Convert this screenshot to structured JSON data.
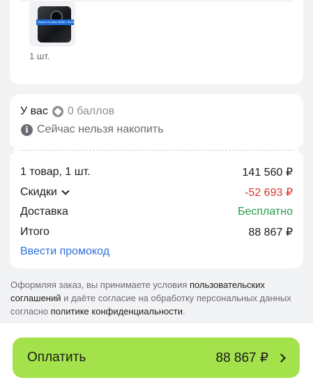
{
  "product": {
    "thumb_label": "Xiaomi 15 Ultra 16GB + 512GB",
    "quantity": "1 шт."
  },
  "points": {
    "you_have": "У вас",
    "balance": "0 баллов",
    "cannot_accumulate": "Сейчас нельзя накопить"
  },
  "summary": {
    "items_label": "1 товар, 1 шт.",
    "items_value": "141 560 ₽",
    "discounts_label": "Скидки",
    "discounts_value": "-52 693 ₽",
    "delivery_label": "Доставка",
    "delivery_value": "Бесплатно",
    "total_label": "Итого",
    "total_value": "88 867 ₽"
  },
  "promo": {
    "label": "Ввести промокод"
  },
  "legal": {
    "part1": "Оформляя заказ, вы принимаете условия ",
    "link1": "пользовательских соглашений",
    "part2": " и даёте согласие на обработку персональных данных согласно ",
    "link2": "политике конфиденциальности",
    "part3": "."
  },
  "pay": {
    "label": "Оплатить",
    "amount": "88 867 ₽"
  },
  "colors": {
    "accent_green": "#a4e24c",
    "discount_red": "#e0332b",
    "free_green": "#1f9e46",
    "link_blue": "#2f6fe0"
  }
}
